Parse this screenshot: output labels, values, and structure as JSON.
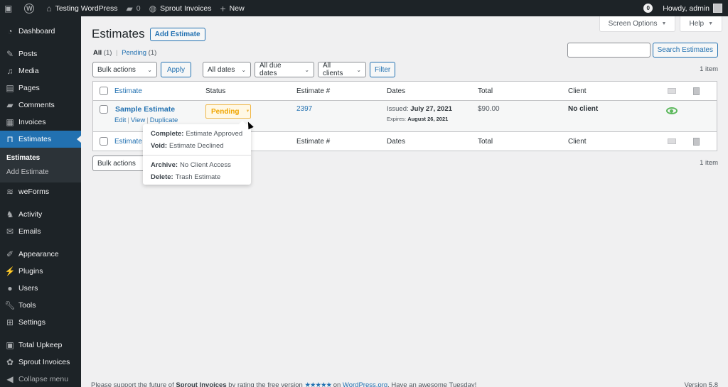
{
  "adminbar": {
    "site_name": "Testing WordPress",
    "comments_count": "0",
    "plugin_item": "Sprout Invoices",
    "new_label": "New",
    "notification_count": "0",
    "greeting": "Howdy, admin"
  },
  "sidebar": {
    "items": [
      {
        "label": "Dashboard",
        "icon": "dashboard-icon"
      },
      {
        "label": "Posts",
        "icon": "pin-icon"
      },
      {
        "label": "Media",
        "icon": "media-icon"
      },
      {
        "label": "Pages",
        "icon": "pages-icon"
      },
      {
        "label": "Comments",
        "icon": "comment-icon"
      },
      {
        "label": "Invoices",
        "icon": "invoice-icon"
      },
      {
        "label": "Estimates",
        "icon": "estimates-icon"
      },
      {
        "label": "weForms",
        "icon": "weforms-icon"
      },
      {
        "label": "Activity",
        "icon": "activity-icon"
      },
      {
        "label": "Emails",
        "icon": "mail-icon"
      },
      {
        "label": "Appearance",
        "icon": "brush-icon"
      },
      {
        "label": "Plugins",
        "icon": "plugin-icon"
      },
      {
        "label": "Users",
        "icon": "user-icon"
      },
      {
        "label": "Tools",
        "icon": "wrench-icon"
      },
      {
        "label": "Settings",
        "icon": "settings-icon"
      },
      {
        "label": "Total Upkeep",
        "icon": "safe-icon"
      },
      {
        "label": "Sprout Invoices",
        "icon": "sprout-icon"
      }
    ],
    "submenu": [
      "Estimates",
      "Add Estimate"
    ],
    "collapse_label": "Collapse menu"
  },
  "screen_meta": {
    "screen_options": "Screen Options",
    "help": "Help"
  },
  "page": {
    "title": "Estimates",
    "add_button": "Add Estimate",
    "views": {
      "all_label": "All",
      "all_count": "(1)",
      "pending_label": "Pending",
      "pending_count": "(1)",
      "separator": "|"
    },
    "search_button": "Search Estimates",
    "search_value": "",
    "items_count": "1 item"
  },
  "tablenav_top": {
    "bulk_actions": "Bulk actions",
    "apply": "Apply",
    "date_filter": "All dates",
    "due_date_filter": "All due dates",
    "client_filter": "All clients",
    "filter": "Filter"
  },
  "tablenav_bottom": {
    "bulk_actions": "Bulk actions"
  },
  "table": {
    "columns": [
      "Estimate",
      "Status",
      "Estimate #",
      "Dates",
      "Total",
      "Client"
    ],
    "rows": [
      {
        "title": "Sample Estimate",
        "actions": [
          "Edit",
          "View",
          "Duplicate"
        ],
        "status": "Pending",
        "number": "2397",
        "issued_label": "Issued:",
        "issued_date": "July 27, 2021",
        "expires_label": "Expires:",
        "expires_date": "August 26, 2021",
        "total": "$90.00",
        "client": "No client"
      }
    ]
  },
  "status_dropdown": {
    "options": [
      {
        "key": "Complete:",
        "desc": "Estimate Approved"
      },
      {
        "key": "Void:",
        "desc": "Estimate Declined"
      },
      {
        "key": "Archive:",
        "desc": "No Client Access"
      },
      {
        "key": "Delete:",
        "desc": "Trash Estimate"
      }
    ]
  },
  "footer": {
    "text_1": "Please support the future of",
    "plugin_name": "Sprout Invoices",
    "text_2": "by rating the free version",
    "stars": "★★★★★",
    "text_3": "on",
    "link": "WordPress.org",
    "text_4": ". Have an awesome Tuesday!",
    "version": "Version 5.8"
  },
  "colors": {
    "accent": "#2271b1",
    "sidebar_bg": "#1d2327",
    "pending": "#f0a500",
    "eye": "#5cb85c"
  }
}
